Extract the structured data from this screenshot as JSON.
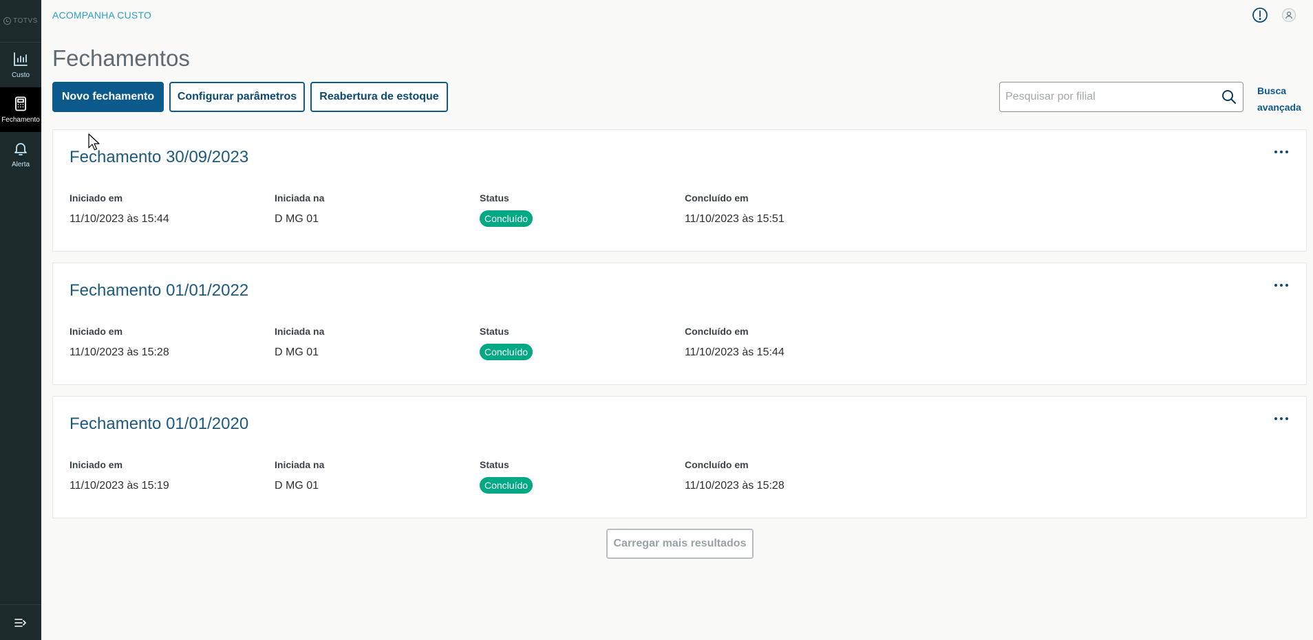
{
  "sidebar": {
    "brand": "TOTVS",
    "items": [
      {
        "label": "Custo",
        "icon": "bar-chart-icon"
      },
      {
        "label": "Fechamento",
        "icon": "calculator-icon"
      },
      {
        "label": "Alerta",
        "icon": "bell-icon"
      }
    ],
    "active": "Fechamento",
    "collapse_icon": "collapse-menu-icon"
  },
  "header": {
    "app_title": "ACOMPANHA CUSTO",
    "info_icon": "info-icon",
    "user_icon": "user-icon"
  },
  "page": {
    "title": "Fechamentos"
  },
  "toolbar": {
    "new_label": "Novo fechamento",
    "config_label": "Configurar parâmetros",
    "reopen_label": "Reabertura de estoque",
    "search_placeholder": "Pesquisar por filial",
    "search_value": "",
    "advanced_line1": "Busca",
    "advanced_line2": "avançada"
  },
  "labels": {
    "started": "Iniciado em",
    "started_at": "Iniciada na",
    "status": "Status",
    "finished": "Concluído em"
  },
  "cards": [
    {
      "title": "Fechamento 30/09/2023",
      "started": "11/10/2023 às 15:44",
      "branch": "D MG 01",
      "status": "Concluído",
      "finished": "11/10/2023 às 15:51"
    },
    {
      "title": "Fechamento 01/01/2022",
      "started": "11/10/2023 às 15:28",
      "branch": "D MG 01",
      "status": "Concluído",
      "finished": "11/10/2023 às 15:44"
    },
    {
      "title": "Fechamento 01/01/2020",
      "started": "11/10/2023 às 15:19",
      "branch": "D MG 01",
      "status": "Concluído",
      "finished": "11/10/2023 às 15:28"
    }
  ],
  "load_more_label": "Carregar mais resultados",
  "colors": {
    "primary": "#0c5a8c",
    "sidebar": "#1c2a2b",
    "success": "#00a884",
    "app_title": "#2aa0c8"
  }
}
